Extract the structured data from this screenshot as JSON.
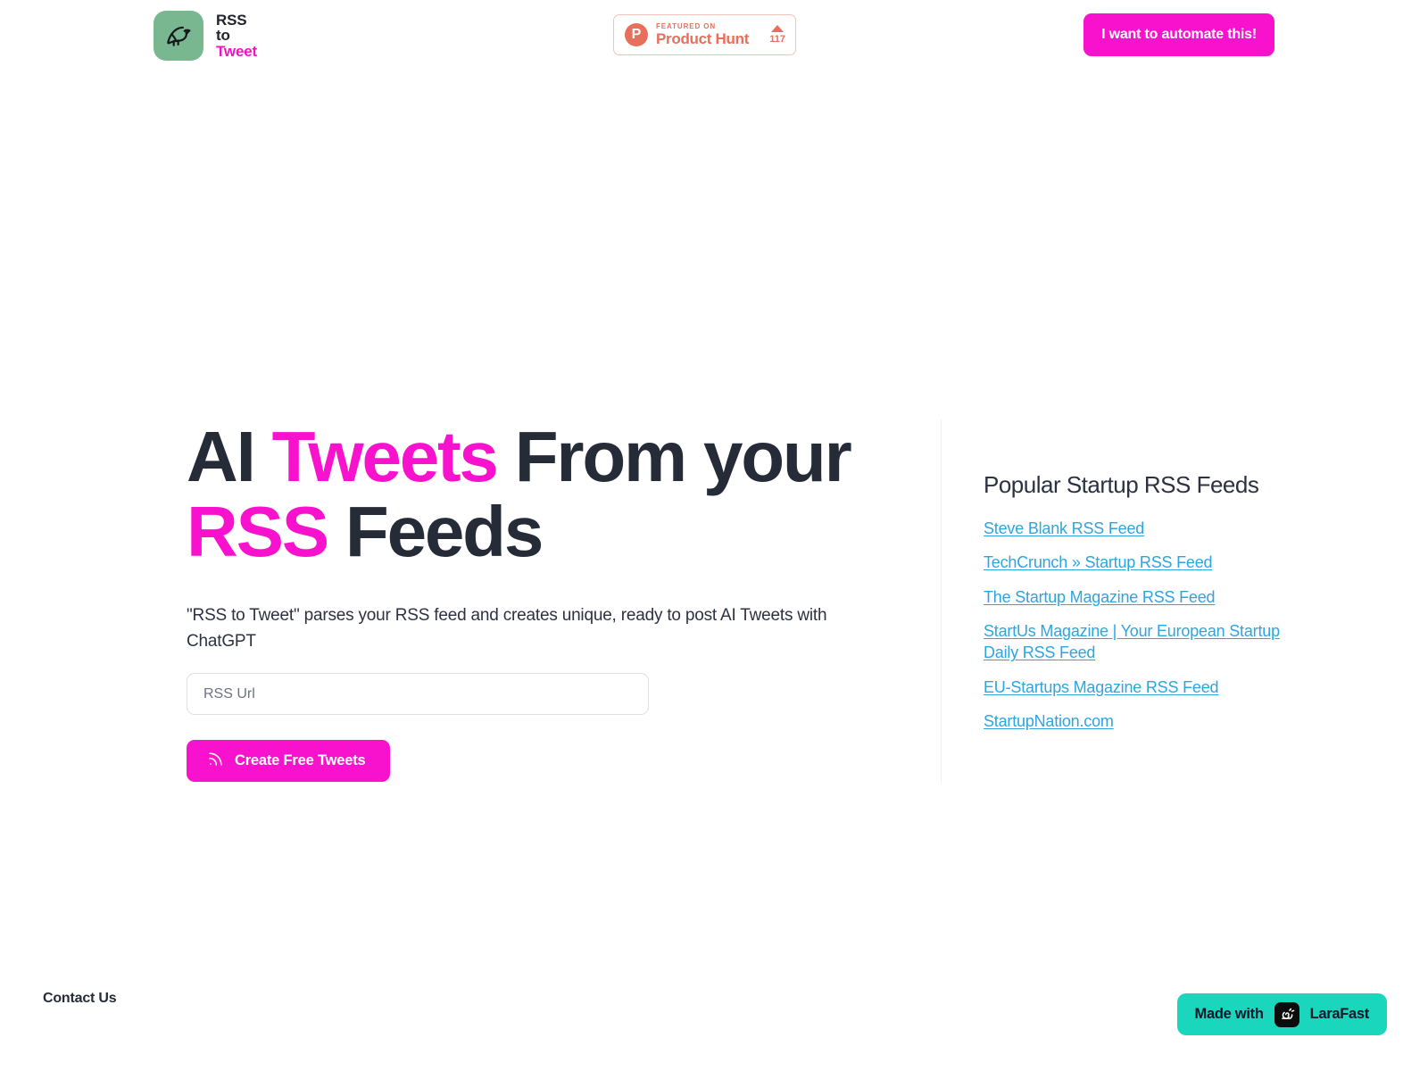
{
  "header": {
    "brand": {
      "icon": "bird-icon",
      "line1": "RSS",
      "line2": "to",
      "line3": "Tweet"
    },
    "product_hunt": {
      "logo_letter": "P",
      "featured_label": "FEATURED ON",
      "name": "Product Hunt",
      "upvotes": "117",
      "arrow_icon": "upvote-arrow-icon"
    },
    "automate_button": "I want to automate this!"
  },
  "hero": {
    "title": {
      "part1": "AI ",
      "highlight1": "Tweets",
      "part2": " From your ",
      "highlight2": "RSS",
      "part3": " Feeds"
    },
    "subtitle": "\"RSS to Tweet\" parses your RSS feed and creates unique, ready to post AI Tweets with ChatGPT",
    "input": {
      "placeholder": "RSS Url",
      "value": ""
    },
    "submit_button": {
      "label": "Create Free Tweets",
      "icon": "rss-icon"
    }
  },
  "sidebar": {
    "title": "Popular Startup RSS Feeds",
    "feeds": [
      {
        "label": "Steve Blank RSS Feed"
      },
      {
        "label": "TechCrunch » Startup RSS Feed"
      },
      {
        "label": "The Startup Magazine RSS Feed"
      },
      {
        "label": "StartUs Magazine | Your European Startup Daily RSS Feed"
      },
      {
        "label": "EU-Startups Magazine RSS Feed"
      },
      {
        "label": "StartupNation.com"
      }
    ]
  },
  "footer": {
    "contact": "Contact Us",
    "larafast": {
      "made_with": "Made with",
      "name": "LaraFast",
      "icon": "snail-icon"
    }
  },
  "colors": {
    "pink": "#f912cd",
    "green": "#79b791",
    "teal": "#1ad6bc",
    "coral": "#e8705a",
    "link_blue": "#2ca5e0",
    "dark": "#262b38"
  }
}
